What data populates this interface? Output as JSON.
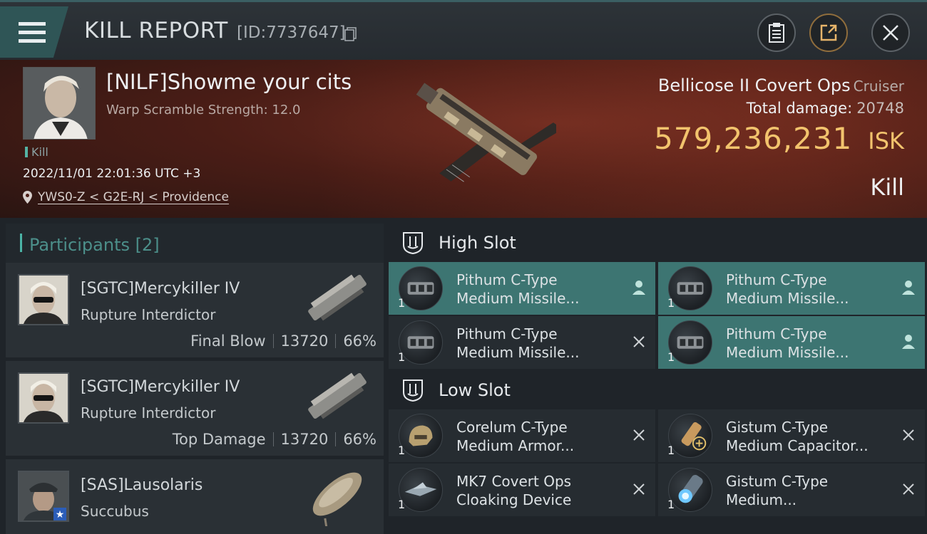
{
  "header": {
    "title": "KILL REPORT",
    "id": "[ID:7737647]"
  },
  "hero": {
    "pilot_name": "[NILF]Showme your cits",
    "warp_scramble": "Warp Scramble Strength: 12.0",
    "kill_tag": "Kill",
    "datetime": "2022/11/01 22:01:36 UTC +3",
    "location": "YWS0-Z < G2E-RJ < Providence",
    "ship_name": "Bellicose II Covert Ops",
    "ship_class": "Cruiser",
    "total_damage_label": "Total damage:",
    "total_damage_value": "20748",
    "isk_amount": "579,236,231",
    "isk_unit": "ISK",
    "result": "Kill"
  },
  "participants": {
    "label": "Participants",
    "count": "[2]",
    "items": [
      {
        "name": "[SGTC]Mercykiller IV",
        "ship": "Rupture Interdictor",
        "role": "Final Blow",
        "damage": "13720",
        "percent": "66%"
      },
      {
        "name": "[SGTC]Mercykiller IV",
        "ship": "Rupture Interdictor",
        "role": "Top Damage",
        "damage": "13720",
        "percent": "66%"
      },
      {
        "name": "[SAS]Lausolaris",
        "ship": "Succubus"
      }
    ]
  },
  "slots": {
    "high": {
      "label": "High Slot",
      "items": [
        {
          "line1": "Pithum C-Type",
          "line2": "Medium Missile...",
          "qty": "1",
          "status": "person"
        },
        {
          "line1": "Pithum C-Type",
          "line2": "Medium Missile...",
          "qty": "1",
          "status": "person"
        },
        {
          "line1": "Pithum C-Type",
          "line2": "Medium Missile...",
          "qty": "1",
          "status": "destroyed"
        },
        {
          "line1": "Pithum C-Type",
          "line2": "Medium Missile...",
          "qty": "1",
          "status": "person"
        }
      ]
    },
    "low": {
      "label": "Low Slot",
      "items": [
        {
          "line1": "Corelum C-Type",
          "line2": "Medium Armor...",
          "qty": "1",
          "status": "destroyed"
        },
        {
          "line1": "Gistum C-Type",
          "line2": "Medium Capacitor...",
          "qty": "1",
          "status": "destroyed"
        },
        {
          "line1": "MK7 Covert Ops",
          "line2": "Cloaking Device",
          "qty": "1",
          "status": "destroyed"
        },
        {
          "line1": "Gistum C-Type",
          "line2": "Medium...",
          "qty": "1",
          "status": "destroyed"
        }
      ]
    }
  },
  "colors": {
    "accent_teal": "#4bb3a6",
    "selected_row": "#3d7572",
    "isk_gold": "#f2c36d"
  }
}
